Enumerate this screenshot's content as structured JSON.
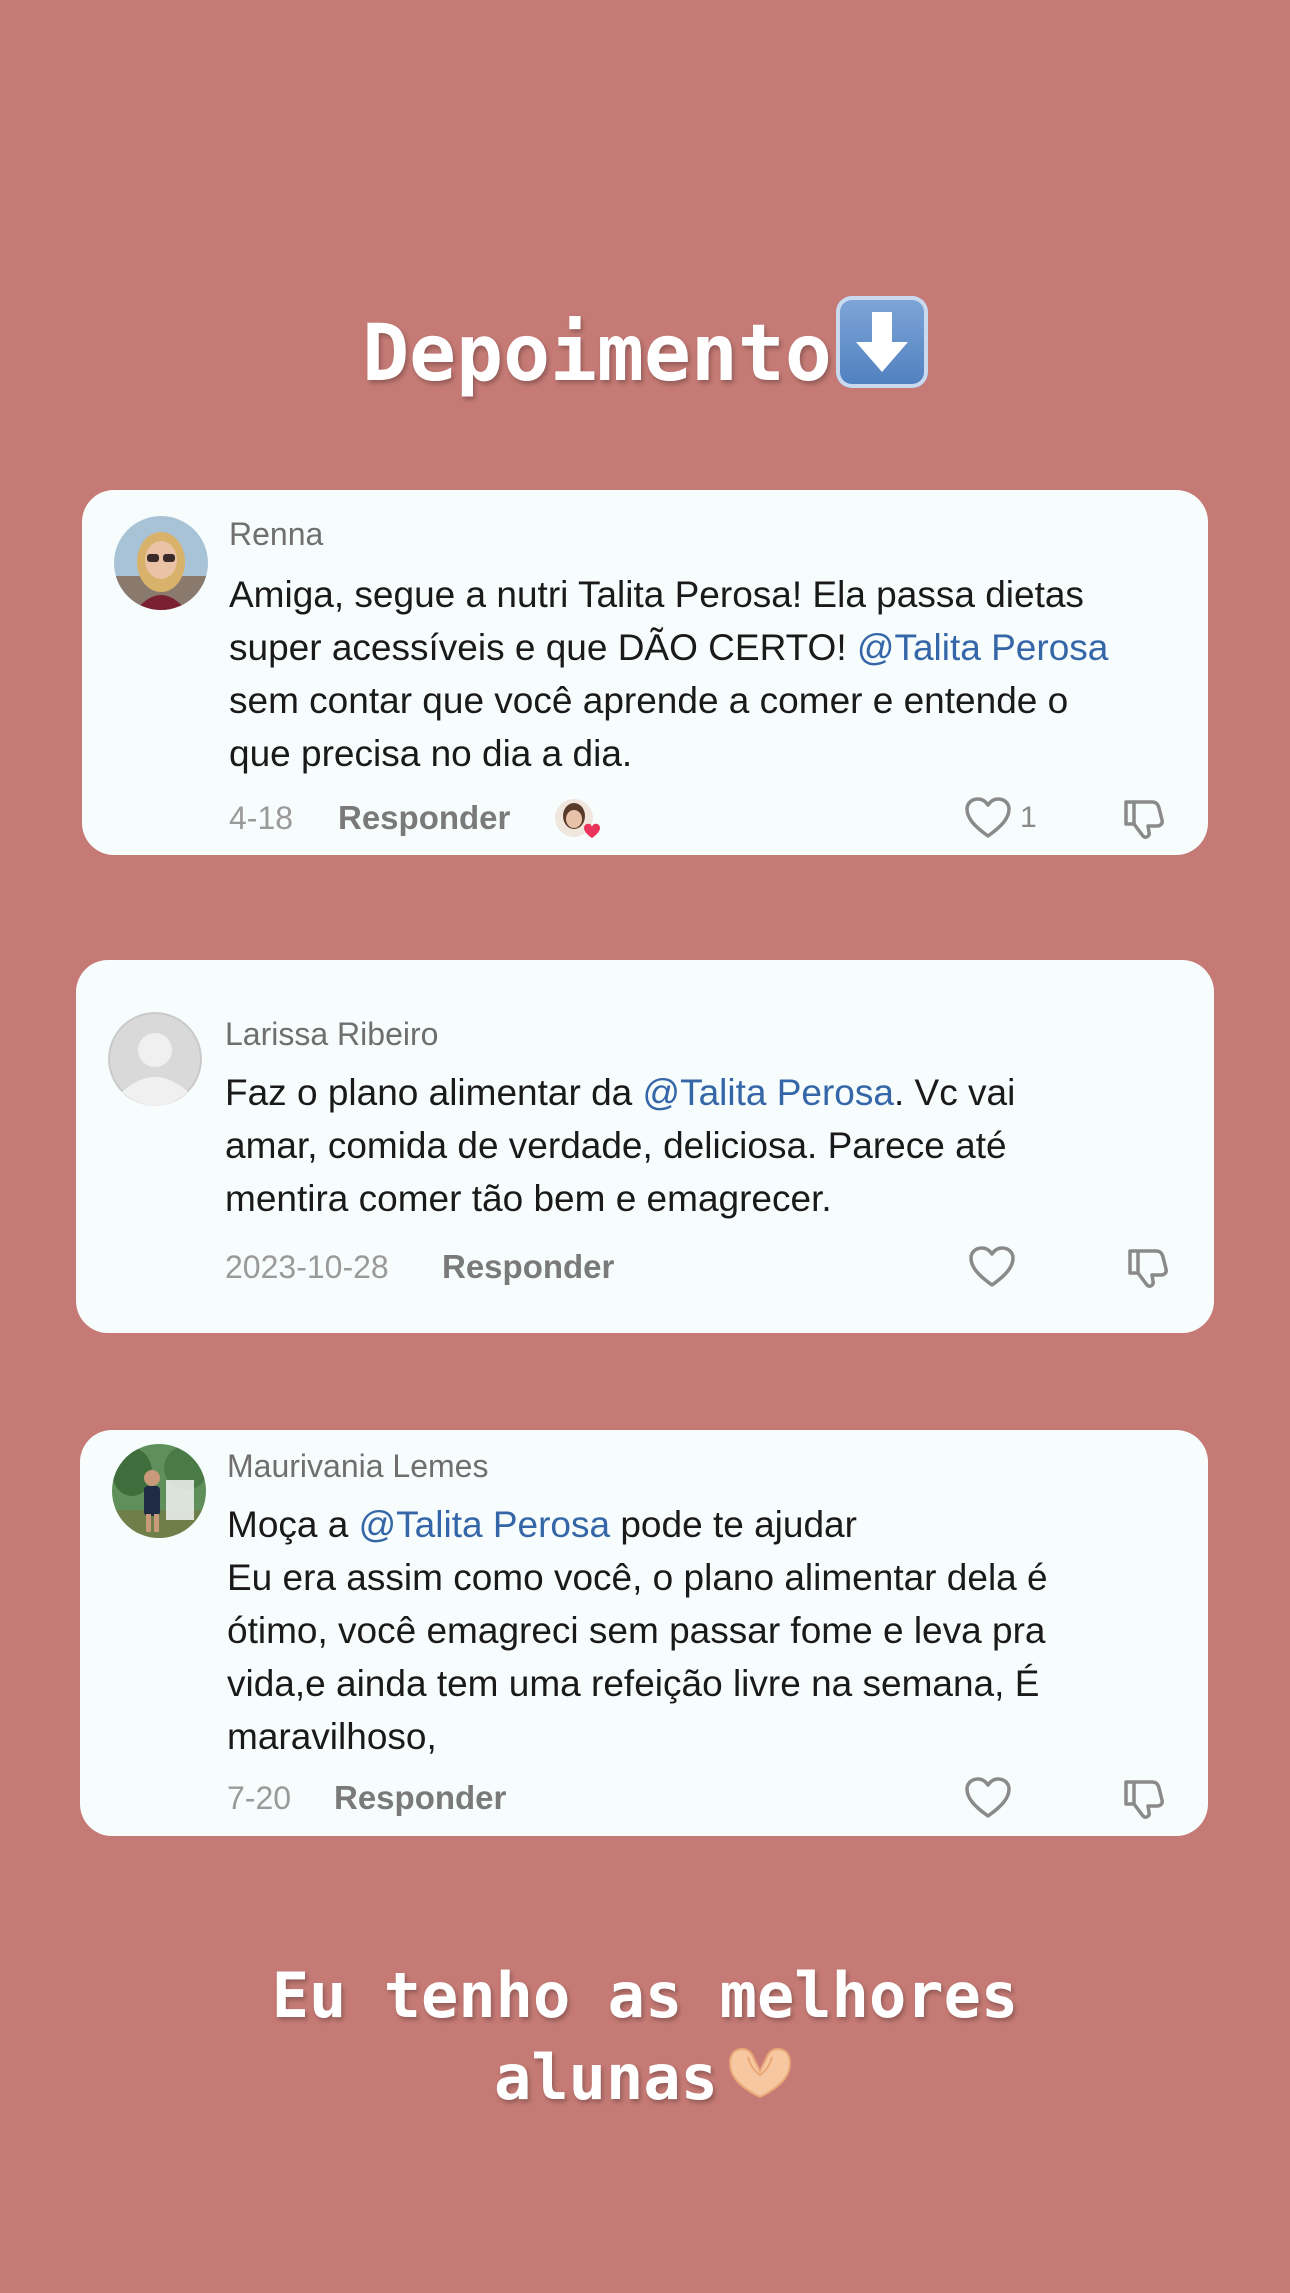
{
  "header": {
    "title": "Depoimento",
    "emoji": "down-arrow-emoji"
  },
  "footer": {
    "text_line1": "Eu tenho as melhores",
    "text_line2": "alunas",
    "emoji": "heart-hands-emoji"
  },
  "comments": [
    {
      "name": "Renna",
      "segments": [
        "Amiga, segue a nutri Talita Perosa! Ela passa dietas\nsuper acessíveis e que DÃO CERTO! ",
        "@Talita Perosa",
        "\nsem contar que você aprende a comer e entende o\nque precisa no dia a dia."
      ],
      "date": "4-18",
      "reply": "Responder",
      "likes": "1"
    },
    {
      "name": "Larissa Ribeiro",
      "segments": [
        "Faz o plano alimentar da ",
        "@Talita Perosa",
        ". Vc vai\namar, comida de verdade, deliciosa. Parece até\nmentira comer tão bem e emagrecer."
      ],
      "date": "2023-10-28",
      "reply": "Responder"
    },
    {
      "name": "Maurivania Lemes",
      "segments": [
        "Moça a ",
        "@Talita Perosa",
        " pode te ajudar\nEu era assim como você, o plano alimentar dela é\nótimo, você emagreci sem passar fome e leva pra\nvida,e ainda tem uma refeição livre na semana, É\nmaravilhoso,"
      ],
      "date": "7-20",
      "reply": "Responder"
    }
  ],
  "colors": {
    "background": "#c57a75",
    "card": "#f7fcfd",
    "mention": "#3566a8"
  }
}
